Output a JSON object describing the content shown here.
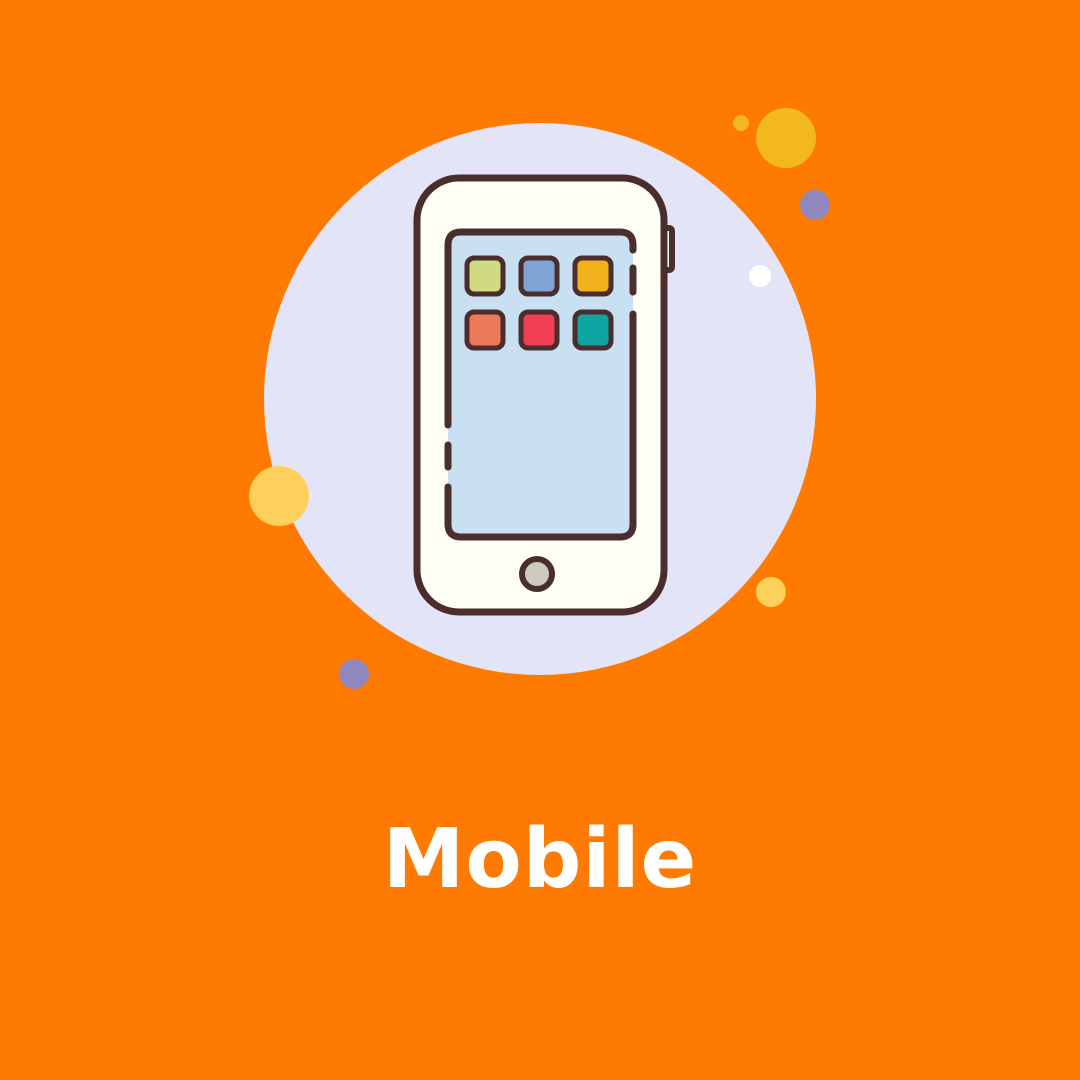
{
  "title": "Mobile",
  "icon": "mobile-phone-icon",
  "colors": {
    "background": "#FF7A00",
    "circle": "#E3E4F8",
    "phone_body": "#FFFEF5",
    "phone_outline": "#4A2E2E",
    "screen": "#C9DFF2",
    "home_button": "#CFC8BC",
    "app_colors": [
      "#D0DA82",
      "#7EA3D4",
      "#F2B11A",
      "#EE7958",
      "#F03F54",
      "#0CA5A2"
    ],
    "dots": {
      "yellow_large": "#F2B81D",
      "yellow_light": "#FDCF5B",
      "purple": "#8E88BF",
      "white": "#FFFFFF"
    }
  }
}
